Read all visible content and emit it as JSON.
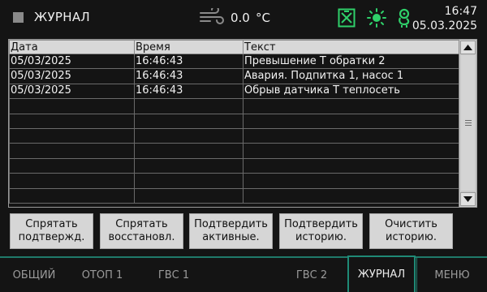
{
  "header": {
    "title": "ЖУРНАЛ",
    "outdoor_temp": "0.0",
    "temp_unit": "°C",
    "time": "16:47",
    "date": "05.03.2025",
    "status_icons": [
      "wind-icon",
      "alarm-icon",
      "sun-icon",
      "pump-icon"
    ],
    "icon_color": "#2fd06a"
  },
  "log": {
    "columns": [
      "Дата",
      "Время",
      "Текст"
    ],
    "rows": [
      {
        "date": "05/03/2025",
        "time": "16:46:43",
        "text": "Превышение Т обратки 2"
      },
      {
        "date": "05/03/2025",
        "time": "16:46:43",
        "text": "Авария. Подпитка 1, насос 1"
      },
      {
        "date": "05/03/2025",
        "time": "16:46:43",
        "text": "Обрыв датчика Т теплосеть"
      },
      {
        "date": "",
        "time": "",
        "text": ""
      },
      {
        "date": "",
        "time": "",
        "text": ""
      },
      {
        "date": "",
        "time": "",
        "text": ""
      },
      {
        "date": "",
        "time": "",
        "text": ""
      },
      {
        "date": "",
        "time": "",
        "text": ""
      },
      {
        "date": "",
        "time": "",
        "text": ""
      },
      {
        "date": "",
        "time": "",
        "text": ""
      }
    ]
  },
  "actions": [
    {
      "line1": "Спрятать",
      "line2": "подтвержд."
    },
    {
      "line1": "Спрятать",
      "line2": "восстановл."
    },
    {
      "line1": "Подтвердить",
      "line2": "активные."
    },
    {
      "line1": "Подтвердить",
      "line2": "историю."
    },
    {
      "line1": "Очистить",
      "line2": "историю."
    }
  ],
  "nav": {
    "general": "ОБЩИЙ",
    "heat1": "ОТОП 1",
    "dhw1": "ГВС 1",
    "dhw2": "ГВС 2",
    "journal": "ЖУРНАЛ",
    "menu": "МЕНЮ",
    "active": "journal",
    "accent": "#1f8a76"
  }
}
